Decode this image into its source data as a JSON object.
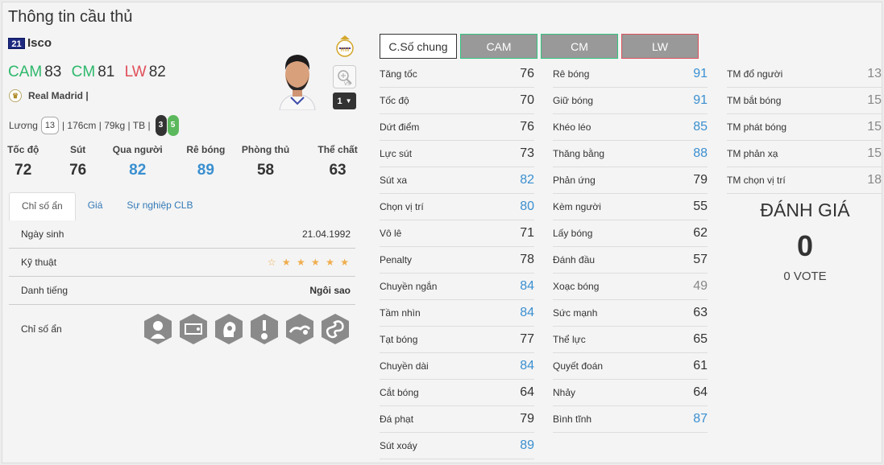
{
  "page_title": "Thông tin cầu thủ",
  "player": {
    "season_badge": "21",
    "name": "Isco",
    "positions": [
      {
        "pos": "CAM",
        "ovr": "83",
        "color": "#2eb86c"
      },
      {
        "pos": "CM",
        "ovr": "81",
        "color": "#2eb86c"
      },
      {
        "pos": "LW",
        "ovr": "82",
        "color": "#e0505a"
      }
    ],
    "club": "Real Madrid |",
    "salary_label": "Lương",
    "salary": "13",
    "physical": "| 176cm | 79kg | TB |",
    "weak_foot": "3",
    "strong_foot": "5",
    "level": "1"
  },
  "main_stats": [
    {
      "label": "Tốc độ",
      "value": "72",
      "color": "#333333"
    },
    {
      "label": "Sút",
      "value": "76",
      "color": "#333333"
    },
    {
      "label": "Qua người",
      "value": "82",
      "color": "#3a8fd0"
    },
    {
      "label": "Rê bóng",
      "value": "89",
      "color": "#3a8fd0"
    },
    {
      "label": "Phòng thủ",
      "value": "58",
      "color": "#333333"
    },
    {
      "label": "Thể chất",
      "value": "63",
      "color": "#333333"
    }
  ],
  "tabs": [
    "Chỉ số ẩn",
    "Giá",
    "Sự nghiệp CLB"
  ],
  "details": {
    "birth_label": "Ngày sinh",
    "birth": "21.04.1992",
    "skill_label": "Kỹ thuật",
    "skill_stars": "☆ ★ ★ ★ ★ ★",
    "fame_label": "Danh tiếng",
    "fame": "Ngôi sao",
    "hidden_label": "Chỉ số ẩn"
  },
  "pos_tabs": [
    "C.Số chung",
    "CAM",
    "CM",
    "LW"
  ],
  "stats_col1": [
    {
      "label": "Tăng tốc",
      "value": "76",
      "c": "dark"
    },
    {
      "label": "Tốc độ",
      "value": "70",
      "c": "dark"
    },
    {
      "label": "Dứt điểm",
      "value": "76",
      "c": "dark"
    },
    {
      "label": "Lực sút",
      "value": "73",
      "c": "dark"
    },
    {
      "label": "Sút xa",
      "value": "82",
      "c": "blue"
    },
    {
      "label": "Chọn vị trí",
      "value": "80",
      "c": "blue"
    },
    {
      "label": "Vô lê",
      "value": "71",
      "c": "dark"
    },
    {
      "label": "Penalty",
      "value": "78",
      "c": "dark"
    },
    {
      "label": "Chuyền ngắn",
      "value": "84",
      "c": "blue"
    },
    {
      "label": "Tầm nhìn",
      "value": "84",
      "c": "blue"
    },
    {
      "label": "Tạt bóng",
      "value": "77",
      "c": "dark"
    },
    {
      "label": "Chuyền dài",
      "value": "84",
      "c": "blue"
    },
    {
      "label": "Cắt bóng",
      "value": "64",
      "c": "dark"
    },
    {
      "label": "Đá phạt",
      "value": "79",
      "c": "dark"
    },
    {
      "label": "Sút xoáy",
      "value": "89",
      "c": "blue"
    }
  ],
  "stats_col2": [
    {
      "label": "Rê bóng",
      "value": "91",
      "c": "blue"
    },
    {
      "label": "Giữ bóng",
      "value": "91",
      "c": "blue"
    },
    {
      "label": "Khéo léo",
      "value": "85",
      "c": "blue"
    },
    {
      "label": "Thăng bằng",
      "value": "88",
      "c": "blue"
    },
    {
      "label": "Phản ứng",
      "value": "79",
      "c": "dark"
    },
    {
      "label": "Kèm người",
      "value": "55",
      "c": "dark"
    },
    {
      "label": "Lấy bóng",
      "value": "62",
      "c": "dark"
    },
    {
      "label": "Đánh đầu",
      "value": "57",
      "c": "dark"
    },
    {
      "label": "Xoạc bóng",
      "value": "49",
      "c": "grey"
    },
    {
      "label": "Sức mạnh",
      "value": "63",
      "c": "dark"
    },
    {
      "label": "Thể lực",
      "value": "65",
      "c": "dark"
    },
    {
      "label": "Quyết đoán",
      "value": "61",
      "c": "dark"
    },
    {
      "label": "Nhảy",
      "value": "64",
      "c": "dark"
    },
    {
      "label": "Bình tĩnh",
      "value": "87",
      "c": "blue"
    }
  ],
  "stats_col3": [
    {
      "label": "TM đổ người",
      "value": "13",
      "c": "grey"
    },
    {
      "label": "TM bắt bóng",
      "value": "15",
      "c": "grey"
    },
    {
      "label": "TM phát bóng",
      "value": "15",
      "c": "grey"
    },
    {
      "label": "TM phản xạ",
      "value": "15",
      "c": "grey"
    },
    {
      "label": "TM chọn vị trí",
      "value": "18",
      "c": "grey"
    }
  ],
  "rating": {
    "title": "ĐÁNH GIÁ",
    "value": "0",
    "votes": "0 VOTE"
  }
}
